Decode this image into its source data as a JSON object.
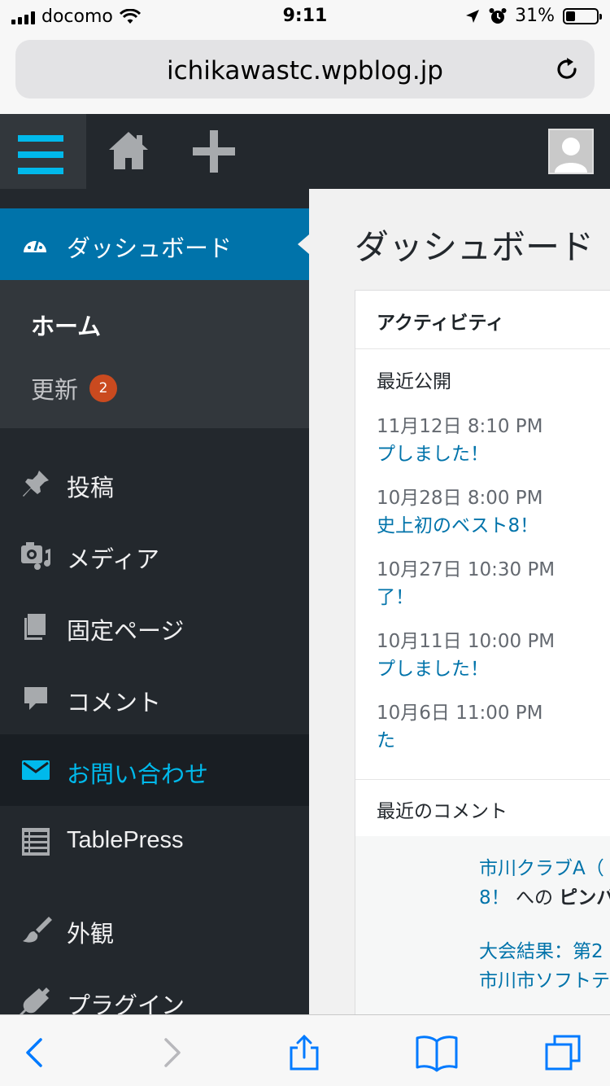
{
  "status_bar": {
    "carrier": "docomo",
    "time": "9:11",
    "battery": "31%",
    "battery_level": 0.31
  },
  "browser": {
    "url": "ichikawastc.wpblog.jp"
  },
  "sidebar": {
    "dashboard_label": "ダッシュボード",
    "submenu": {
      "home": "ホーム",
      "update": "更新",
      "update_count": "2"
    },
    "items": [
      {
        "label": "投稿",
        "icon": "pin-icon"
      },
      {
        "label": "メディア",
        "icon": "media-icon"
      },
      {
        "label": "固定ページ",
        "icon": "pages-icon"
      },
      {
        "label": "コメント",
        "icon": "comment-icon"
      },
      {
        "label": "お問い合わせ",
        "icon": "mail-icon",
        "current": true
      },
      {
        "label": "TablePress",
        "icon": "table-icon"
      },
      {
        "label": "外観",
        "icon": "brush-icon"
      },
      {
        "label": "プラグイン",
        "icon": "plugin-icon"
      }
    ]
  },
  "main": {
    "title": "ダッシュボード",
    "activity": {
      "title": "アクティビティ",
      "recent_published": "最近公開",
      "posts": [
        {
          "date": "11月12日 8:10 PM",
          "title": "プしました！"
        },
        {
          "date": "10月28日 8:00 PM",
          "title": "史上初のベスト8！"
        },
        {
          "date": "10月27日 10:30 PM",
          "title": "了！"
        },
        {
          "date": "10月11日 10:00 PM",
          "title": "プしました！"
        },
        {
          "date": "10月6日 11:00 PM",
          "title": "た"
        }
      ],
      "recent_comments": "最近のコメント",
      "comments": [
        {
          "line1": "市川クラブA（",
          "line2_link": "8！",
          "line2_text": " への ",
          "line2_bold": "ピンバ"
        },
        {
          "line1": "大会結果：第2",
          "line2_link": "市川市ソフトテ",
          "line2_text": "",
          "line2_bold": ""
        }
      ]
    }
  },
  "colors": {
    "admin_bar": "#23282d",
    "accent_blue": "#0073aa",
    "highlight_cyan": "#00b9eb",
    "badge_orange": "#ca4a1f",
    "ios_blue": "#007aff"
  }
}
